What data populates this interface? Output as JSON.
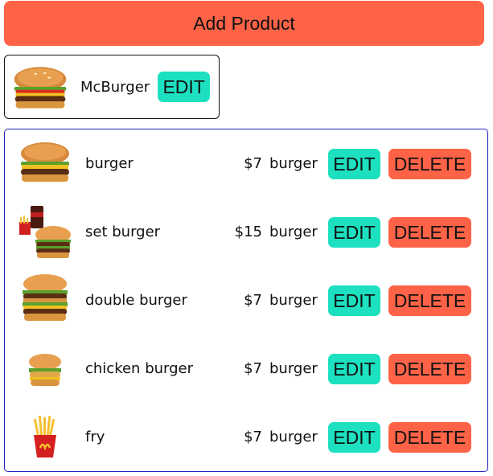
{
  "header": {
    "add_product_label": "Add Product"
  },
  "store": {
    "name": "McBurger",
    "edit_label": "EDIT",
    "image_icon": "burger-icon"
  },
  "products": [
    {
      "name": "burger",
      "price": "$7",
      "category": "burger",
      "edit_label": "EDIT",
      "delete_label": "DELETE",
      "image_icon": "burger-icon"
    },
    {
      "name": "set burger",
      "price": "$15",
      "category": "burger",
      "edit_label": "EDIT",
      "delete_label": "DELETE",
      "image_icon": "set-meal-icon"
    },
    {
      "name": "double burger",
      "price": "$7",
      "category": "burger",
      "edit_label": "EDIT",
      "delete_label": "DELETE",
      "image_icon": "double-burger-icon"
    },
    {
      "name": "chicken burger",
      "price": "$7",
      "category": "burger",
      "edit_label": "EDIT",
      "delete_label": "DELETE",
      "image_icon": "chicken-burger-icon"
    },
    {
      "name": "fry",
      "price": "$7",
      "category": "burger",
      "edit_label": "EDIT",
      "delete_label": "DELETE",
      "image_icon": "fries-icon"
    }
  ],
  "colors": {
    "add_button": "#ff6347",
    "edit_button": "#1de0c0",
    "delete_button": "#ff6347",
    "list_border": "#2020c0"
  }
}
